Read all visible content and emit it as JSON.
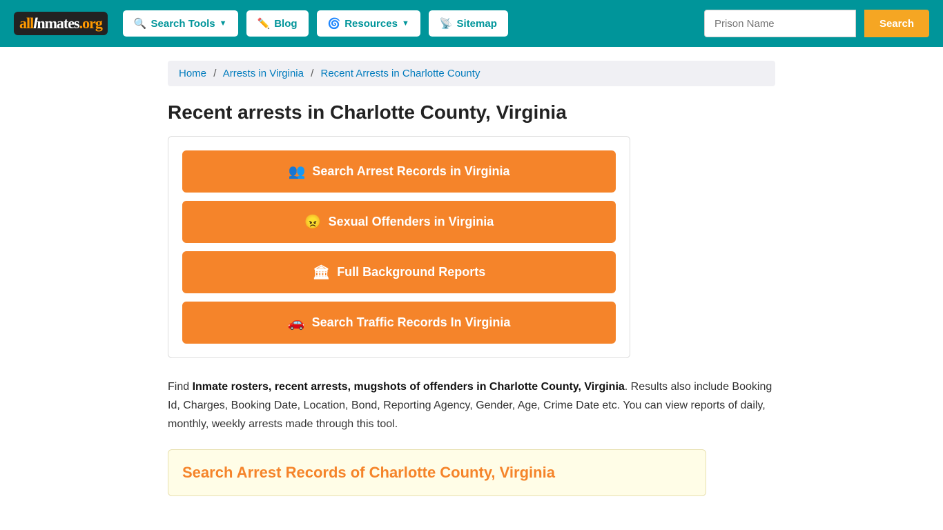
{
  "header": {
    "logo": {
      "all": "all",
      "inmates": "Inmates",
      "org": ".org"
    },
    "nav": [
      {
        "id": "search-tools",
        "label": "Search Tools",
        "icon": "🔍",
        "hasDropdown": true
      },
      {
        "id": "blog",
        "label": "Blog",
        "icon": "✏️",
        "hasDropdown": false
      },
      {
        "id": "resources",
        "label": "Resources",
        "icon": "🌀",
        "hasDropdown": true
      },
      {
        "id": "sitemap",
        "label": "Sitemap",
        "icon": "📡",
        "hasDropdown": false
      }
    ],
    "search_placeholder": "Prison Name",
    "search_button_label": "Search"
  },
  "breadcrumb": {
    "home": "Home",
    "arrests_in_virginia": "Arrests in Virginia",
    "current": "Recent Arrests in Charlotte County"
  },
  "page": {
    "title": "Recent arrests in Charlotte County, Virginia",
    "action_buttons": [
      {
        "id": "arrest-records",
        "icon": "👥",
        "label": "Search Arrest Records in Virginia"
      },
      {
        "id": "sexual-offenders",
        "icon": "😠",
        "label": "Sexual Offenders in Virginia"
      },
      {
        "id": "background-reports",
        "icon": "🏛",
        "label": "Full Background Reports"
      },
      {
        "id": "traffic-records",
        "icon": "🚗",
        "label": "Search Traffic Records In Virginia"
      }
    ],
    "description": {
      "prefix": "Find ",
      "bold_text": "Inmate rosters, recent arrests, mugshots of offenders in Charlotte County, Virginia",
      "suffix": ". Results also include Booking Id, Charges, Booking Date, Location, Bond, Reporting Agency, Gender, Age, Crime Date etc. You can view reports of daily, monthly, weekly arrests made through this tool."
    },
    "search_section_title": "Search Arrest Records of Charlotte County, Virginia"
  }
}
